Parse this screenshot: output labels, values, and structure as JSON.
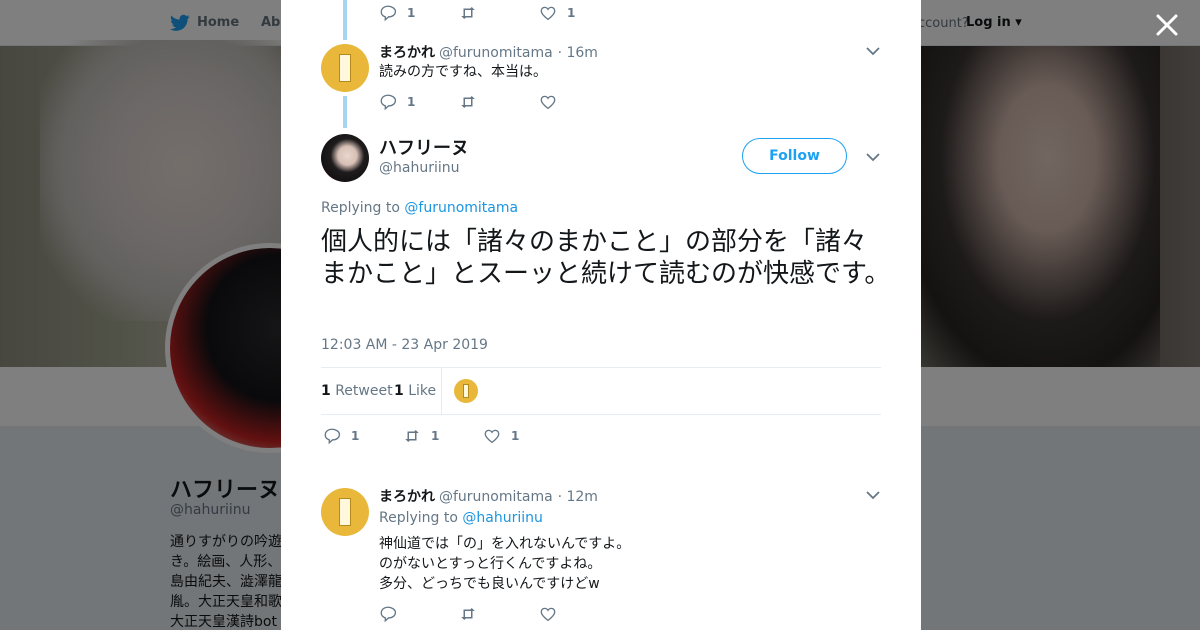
{
  "topbar": {
    "home": "Home",
    "about": "Abo",
    "account_prompt": "ccount?",
    "login": "Log in"
  },
  "profile": {
    "name": "ハフリーヌ",
    "handle": "@hahuriinu",
    "bio_lines": [
      "通りすがりの吟遊",
      "き。絵画、人形、",
      "島由紀夫、澁澤龍",
      "胤。大正天皇和歌",
      "大正天皇漢詩bot"
    ]
  },
  "thread": {
    "top_actions": {
      "replies": "1",
      "retweets": "",
      "likes": "1"
    },
    "reply1": {
      "name": "まろかれ",
      "handle": "@furunomitama",
      "time": "· 16m",
      "text": "読みの方ですね、本当は。",
      "actions": {
        "replies": "1",
        "retweets": "",
        "likes": ""
      }
    },
    "main": {
      "name": "ハフリーヌ",
      "handle": "@hahuriinu",
      "follow": "Follow",
      "replying_label": "Replying to",
      "replying_to": "@furunomitama",
      "text": "個人的には「諸々のまかこと」の部分を「諸々まかこと」とスーッと続けて読むのが快感です。",
      "timestamp": "12:03 AM - 23 Apr 2019",
      "retweet_count": "1",
      "retweet_label": "Retweet",
      "like_count": "1",
      "like_label": "Like",
      "actions": {
        "replies": "1",
        "retweets": "1",
        "likes": "1"
      }
    },
    "reply2": {
      "name": "まろかれ",
      "handle": "@furunomitama",
      "time": "· 12m",
      "replying_label": "Replying to",
      "replying_to": "@hahuriinu",
      "lines": [
        "神仙道では「の」を入れないんですよ。",
        "のがないとすっと行くんですよね。",
        "多分、どっちでも良いんですけどw"
      ],
      "actions": {
        "replies": "",
        "retweets": "",
        "likes": ""
      }
    }
  },
  "colors": {
    "accent": "#1da1f2",
    "thread_line": "#a6d5f2",
    "muted": "#657786"
  }
}
